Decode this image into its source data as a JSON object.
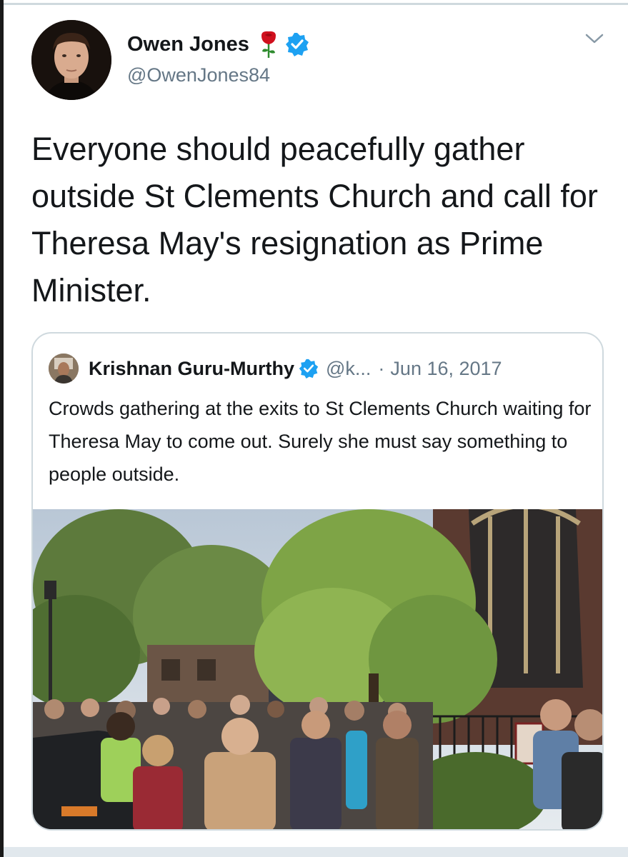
{
  "tweet": {
    "author": {
      "display_name": "Owen Jones",
      "handle": "@OwenJones84",
      "verified": true,
      "name_emoji": "rose-icon"
    },
    "text": "Everyone should peacefully gather outside St Clements Church and call for Theresa May's resignation as Prime Minister.",
    "menu_icon": "chevron-down-icon"
  },
  "quoted_tweet": {
    "author": {
      "display_name": "Krishnan Guru-Murthy",
      "handle": "@k...",
      "verified": true
    },
    "separator": "·",
    "date": "Jun 16, 2017",
    "text": "Crowds gathering at the exits to St Clements Church waiting for Theresa May to come out. Surely she must say something to people outside.",
    "media": "photo"
  },
  "colors": {
    "text_primary": "#14171a",
    "text_secondary": "#657786",
    "verified_blue": "#1da1f2",
    "border": "#cfd9de",
    "rose_red": "#d0101e"
  }
}
